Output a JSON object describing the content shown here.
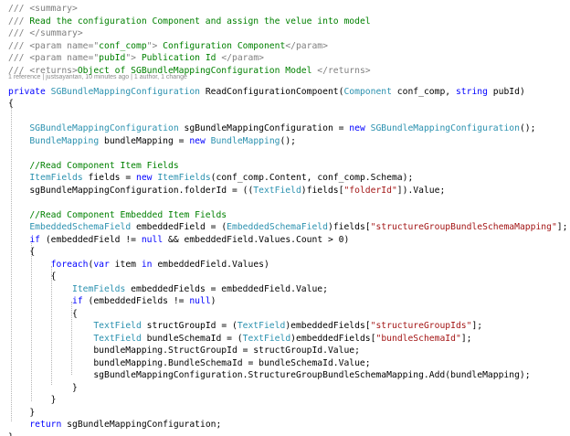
{
  "editor": {
    "colors": {
      "background": "#ffffff",
      "keyword": "#0000ff",
      "type": "#2b91af",
      "string": "#a31515",
      "comment": "#008000",
      "doc_tag": "#808080",
      "plain": "#000000",
      "codelens": "#8a8a8a",
      "indent_guide": "#b4b4b4"
    },
    "codelens": "1 reference | justsayantan, 10 minutes ago | 1 author, 1 change",
    "lines": [
      [
        {
          "k": "doc-tag",
          "t": "/// <summary>"
        }
      ],
      [
        {
          "k": "doc-tag",
          "t": "/// "
        },
        {
          "k": "comment",
          "t": "Read the configuration Component and assign the velue into model"
        }
      ],
      [
        {
          "k": "doc-tag",
          "t": "/// </summary>"
        }
      ],
      [
        {
          "k": "doc-tag",
          "t": "/// <param name=\""
        },
        {
          "k": "comment",
          "t": "conf_comp"
        },
        {
          "k": "doc-tag",
          "t": "\">"
        },
        {
          "k": "comment",
          "t": " Configuration Component"
        },
        {
          "k": "doc-tag",
          "t": "</param>"
        }
      ],
      [
        {
          "k": "doc-tag",
          "t": "/// <param name=\""
        },
        {
          "k": "comment",
          "t": "pubId"
        },
        {
          "k": "doc-tag",
          "t": "\">"
        },
        {
          "k": "comment",
          "t": " Publication Id "
        },
        {
          "k": "doc-tag",
          "t": "</param>"
        }
      ],
      [
        {
          "k": "doc-tag",
          "t": "/// <returns>"
        },
        {
          "k": "comment",
          "t": "Object of SGBundleMappingConfiguration Model "
        },
        {
          "k": "doc-tag",
          "t": "</returns>"
        }
      ],
      [
        {
          "k": "keyword",
          "t": "private "
        },
        {
          "k": "type",
          "t": "SGBundleMappingConfiguration"
        },
        {
          "k": "plain",
          "t": " ReadConfigurationCompoent("
        },
        {
          "k": "type",
          "t": "Component"
        },
        {
          "k": "plain",
          "t": " conf_comp, "
        },
        {
          "k": "keyword",
          "t": "string"
        },
        {
          "k": "plain",
          "t": " pubId)"
        }
      ],
      [
        {
          "k": "plain",
          "t": "{"
        }
      ],
      [],
      [
        {
          "k": "plain",
          "t": "    "
        },
        {
          "k": "type",
          "t": "SGBundleMappingConfiguration"
        },
        {
          "k": "plain",
          "t": " sgBundleMappingConfiguration = "
        },
        {
          "k": "keyword",
          "t": "new "
        },
        {
          "k": "type",
          "t": "SGBundleMappingConfiguration"
        },
        {
          "k": "plain",
          "t": "();"
        }
      ],
      [
        {
          "k": "plain",
          "t": "    "
        },
        {
          "k": "type",
          "t": "BundleMapping"
        },
        {
          "k": "plain",
          "t": " bundleMapping = "
        },
        {
          "k": "keyword",
          "t": "new "
        },
        {
          "k": "type",
          "t": "BundleMapping"
        },
        {
          "k": "plain",
          "t": "();"
        }
      ],
      [],
      [
        {
          "k": "plain",
          "t": "    "
        },
        {
          "k": "comment",
          "t": "//Read Component Item Fields"
        }
      ],
      [
        {
          "k": "plain",
          "t": "    "
        },
        {
          "k": "type",
          "t": "ItemFields"
        },
        {
          "k": "plain",
          "t": " fields = "
        },
        {
          "k": "keyword",
          "t": "new "
        },
        {
          "k": "type",
          "t": "ItemFields"
        },
        {
          "k": "plain",
          "t": "(conf_comp.Content, conf_comp.Schema);"
        }
      ],
      [
        {
          "k": "plain",
          "t": "    sgBundleMappingConfiguration.folderId = (("
        },
        {
          "k": "type",
          "t": "TextField"
        },
        {
          "k": "plain",
          "t": ")fields["
        },
        {
          "k": "string",
          "t": "\"folderId\""
        },
        {
          "k": "plain",
          "t": "]).Value;"
        }
      ],
      [],
      [
        {
          "k": "plain",
          "t": "    "
        },
        {
          "k": "comment",
          "t": "//Read Component Embedded Item Fields"
        }
      ],
      [
        {
          "k": "plain",
          "t": "    "
        },
        {
          "k": "type",
          "t": "EmbeddedSchemaField"
        },
        {
          "k": "plain",
          "t": " embeddedField = ("
        },
        {
          "k": "type",
          "t": "EmbeddedSchemaField"
        },
        {
          "k": "plain",
          "t": ")fields["
        },
        {
          "k": "string",
          "t": "\"structureGroupBundleSchemaMapping\""
        },
        {
          "k": "plain",
          "t": "];"
        }
      ],
      [
        {
          "k": "plain",
          "t": "    "
        },
        {
          "k": "keyword",
          "t": "if"
        },
        {
          "k": "plain",
          "t": " (embeddedField != "
        },
        {
          "k": "keyword",
          "t": "null"
        },
        {
          "k": "plain",
          "t": " && embeddedField.Values.Count > 0)"
        }
      ],
      [
        {
          "k": "plain",
          "t": "    {"
        }
      ],
      [
        {
          "k": "plain",
          "t": "        "
        },
        {
          "k": "keyword",
          "t": "foreach"
        },
        {
          "k": "plain",
          "t": "("
        },
        {
          "k": "keyword",
          "t": "var"
        },
        {
          "k": "plain",
          "t": " item "
        },
        {
          "k": "keyword",
          "t": "in"
        },
        {
          "k": "plain",
          "t": " embeddedField.Values)"
        }
      ],
      [
        {
          "k": "plain",
          "t": "        {"
        }
      ],
      [
        {
          "k": "plain",
          "t": "            "
        },
        {
          "k": "type",
          "t": "ItemFields"
        },
        {
          "k": "plain",
          "t": " embeddedFields = embeddedField.Value;"
        }
      ],
      [
        {
          "k": "plain",
          "t": "            "
        },
        {
          "k": "keyword",
          "t": "if"
        },
        {
          "k": "plain",
          "t": " (embeddedFields != "
        },
        {
          "k": "keyword",
          "t": "null"
        },
        {
          "k": "plain",
          "t": ")"
        }
      ],
      [
        {
          "k": "plain",
          "t": "            {"
        }
      ],
      [
        {
          "k": "plain",
          "t": "                "
        },
        {
          "k": "type",
          "t": "TextField"
        },
        {
          "k": "plain",
          "t": " structGroupId = ("
        },
        {
          "k": "type",
          "t": "TextField"
        },
        {
          "k": "plain",
          "t": ")embeddedFields["
        },
        {
          "k": "string",
          "t": "\"structureGroupIds\""
        },
        {
          "k": "plain",
          "t": "];"
        }
      ],
      [
        {
          "k": "plain",
          "t": "                "
        },
        {
          "k": "type",
          "t": "TextField"
        },
        {
          "k": "plain",
          "t": " bundleSchemaId = ("
        },
        {
          "k": "type",
          "t": "TextField"
        },
        {
          "k": "plain",
          "t": ")embeddedFields["
        },
        {
          "k": "string",
          "t": "\"bundleSchemaId\""
        },
        {
          "k": "plain",
          "t": "];"
        }
      ],
      [
        {
          "k": "plain",
          "t": "                bundleMapping.StructGroupId = structGroupId.Value;"
        }
      ],
      [
        {
          "k": "plain",
          "t": "                bundleMapping.BundleSchemaId = bundleSchemaId.Value;"
        }
      ],
      [
        {
          "k": "plain",
          "t": "                sgBundleMappingConfiguration.StructureGroupBundleSchemaMapping.Add(bundleMapping);"
        }
      ],
      [
        {
          "k": "plain",
          "t": "            }"
        }
      ],
      [
        {
          "k": "plain",
          "t": "        }"
        }
      ],
      [
        {
          "k": "plain",
          "t": "    }"
        }
      ],
      [
        {
          "k": "plain",
          "t": "    "
        },
        {
          "k": "keyword",
          "t": "return"
        },
        {
          "k": "plain",
          "t": " sgBundleMappingConfiguration;"
        }
      ],
      [
        {
          "k": "plain",
          "t": "}"
        }
      ]
    ]
  }
}
